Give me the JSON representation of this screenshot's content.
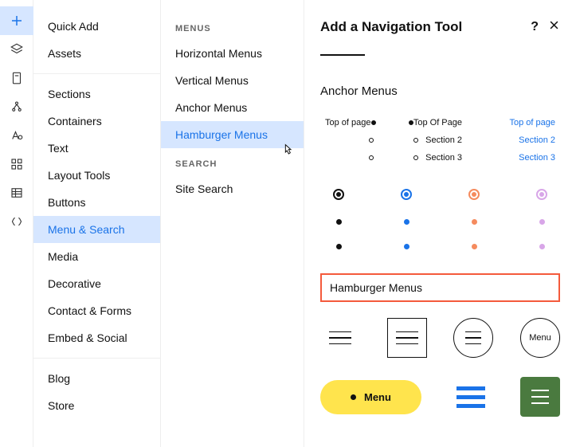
{
  "col1": {
    "group1": [
      "Quick Add",
      "Assets"
    ],
    "group2": [
      "Sections",
      "Containers",
      "Text",
      "Layout Tools",
      "Buttons",
      "Menu & Search",
      "Media",
      "Decorative",
      "Contact & Forms",
      "Embed & Social"
    ],
    "group3": [
      "Blog",
      "Store"
    ],
    "selected": "Menu & Search"
  },
  "col2": {
    "heading_menus": "MENUS",
    "menus": [
      "Horizontal Menus",
      "Vertical Menus",
      "Anchor Menus",
      "Hamburger Menus"
    ],
    "selected": "Hamburger Menus",
    "heading_search": "SEARCH",
    "search": [
      "Site Search"
    ]
  },
  "panel": {
    "title": "Add a Navigation Tool",
    "help": "?",
    "anchor_title": "Anchor Menus",
    "anchor_cards": [
      {
        "labels": [
          "Top of page",
          "",
          ""
        ],
        "style": "left-filled"
      },
      {
        "labels": [
          "Top Of Page",
          "Section 2",
          "Section 3"
        ],
        "style": "right"
      },
      {
        "labels": [
          "Top of page",
          "Section 2",
          "Section 3"
        ],
        "style": "link"
      }
    ],
    "dot_colors": [
      "#111111",
      "#1a73e8",
      "#f58b5e",
      "#d8a6e8"
    ],
    "hamburger_title": "Hamburger Menus",
    "menu_text": "Menu",
    "pill_text": "Menu"
  }
}
